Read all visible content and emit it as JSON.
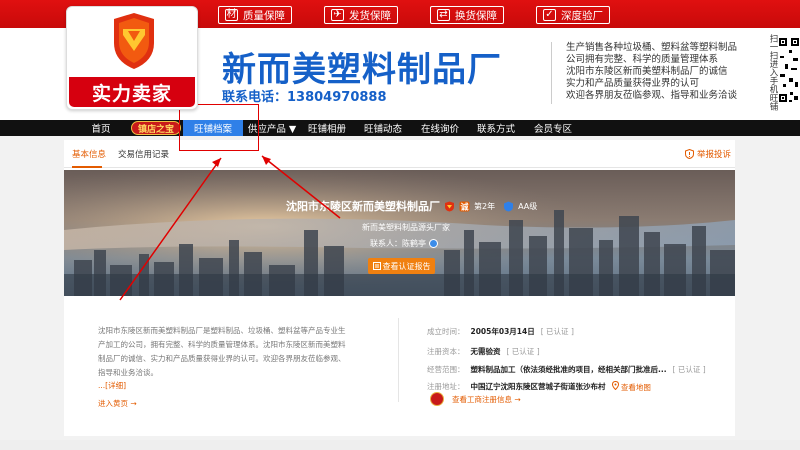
{
  "top_guarantees": [
    {
      "icon": "材",
      "label": "质量保障"
    },
    {
      "icon": "✈",
      "label": "发货保障"
    },
    {
      "icon": "⇄",
      "label": "换货保障"
    },
    {
      "icon": "✓",
      "label": "深度验厂"
    }
  ],
  "logo": {
    "badge_text": "实力卖家"
  },
  "header": {
    "company_name": "新而美塑料制品厂",
    "contact": "联系电话：13804970888",
    "intro_lines": [
      "生产销售各种垃圾桶、塑料盆等塑料制品",
      "公司拥有完整、科学的质量管理体系",
      "沈阳市东陵区新而美塑料制品厂的诚信",
      "实力和产品质量获得业界的认可",
      "欢迎各界朋友莅临参观、指导和业务洽谈"
    ],
    "qr_caption": "扫一扫进入手机旺铺"
  },
  "nav": {
    "items": [
      "首页",
      "旺铺档案",
      "供应产品 ▼",
      "旺铺相册",
      "旺铺动态",
      "在线询价",
      "联系方式",
      "会员专区"
    ],
    "badge": "镇店之宝",
    "active_index": 1
  },
  "tabs": {
    "items": [
      "基本信息",
      "交易信用记录"
    ],
    "report": "举报投诉"
  },
  "banner": {
    "company": "沈阳市东陵区新而美塑料制品厂",
    "years": "第2年",
    "grade": "AA级",
    "subtitle": "新而美塑料制品源头厂家",
    "person": "联系人：陈鹤亭",
    "cert_button": "查看认证报告"
  },
  "profile": {
    "description": "沈阳市东陵区新而美塑料制品厂是塑料制品、垃圾桶、塑料盆等产品专业生产加工的公司，拥有完整、科学的质量管理体系。沈阳市东陵区新而美塑料制品厂的诚信、实力和产品质量获得业界的认可。欢迎各界朋友莅临参观、指导和业务洽谈。",
    "more": "...[详细]",
    "enter_shop": "进入黄页 →",
    "fields": [
      {
        "label": "成立时间：",
        "value": "2005年03月14日",
        "cert": "[ 已认证 ]"
      },
      {
        "label": "注册资本：",
        "value": "无需验资",
        "cert": "[ 已认证 ]"
      },
      {
        "label": "经营范围：",
        "value": "塑料制品加工（依法须经批准的项目，经相关部门批准后...",
        "cert": "[ 已认证 ]"
      },
      {
        "label": "注册地址：",
        "value": "中国辽宁沈阳东陵区营城子街道张沙布村",
        "cert": ""
      }
    ],
    "map_link": "查看地图",
    "bureau_link": "查看工商注册信息 →"
  },
  "colors": {
    "brand_red": "#d6000f",
    "brand_blue": "#1560c8",
    "accent_orange": "#e35b00",
    "nav_active": "#2f80e8"
  }
}
